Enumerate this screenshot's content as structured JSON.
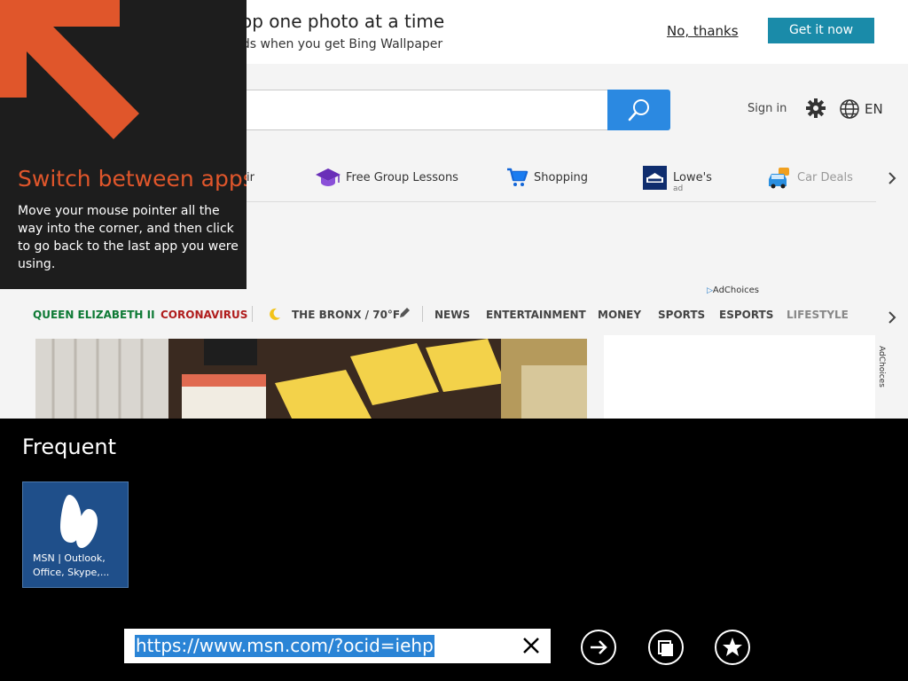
{
  "promo": {
    "line1": "m your desktop one photo at a time",
    "line2": "ch daily backgrounds when you get Bing Wallpaper",
    "no_thanks": "No, thanks",
    "get_it_now": "Get it now"
  },
  "header": {
    "sign_in": "Sign in",
    "language": "EN",
    "gear_icon": "gear-icon",
    "globe_icon": "globe-icon",
    "search_icon": "search-icon"
  },
  "quick_links": [
    {
      "label": "ir",
      "icon": "partial-icon"
    },
    {
      "label": "Free Group Lessons",
      "icon": "graduation-cap-icon"
    },
    {
      "label": "Shopping",
      "icon": "shopping-cart-icon"
    },
    {
      "label": "Lowe's",
      "sub": "ad",
      "icon": "lowes-logo-icon"
    },
    {
      "label": "Car Deals",
      "icon": "car-icon"
    }
  ],
  "ad_choices": "AdChoices",
  "nav": {
    "items": [
      "QUEEN ELIZABETH II",
      "CORONAVIRUS",
      "THE BRONX / 70°F",
      "NEWS",
      "ENTERTAINMENT",
      "MONEY",
      "SPORTS",
      "ESPORTS",
      "LIFESTYLE"
    ],
    "weather_icon": "moon-icon",
    "edit_icon": "pencil-icon"
  },
  "tip": {
    "title": "Switch between apps",
    "body": "Move your mouse pointer all the way into the corner, and then click to go back to the last app you were using."
  },
  "frequent": {
    "heading": "Frequent",
    "tiles": [
      {
        "label": "MSN | Outlook, Office, Skype,...",
        "icon": "msn-butterfly-icon"
      }
    ]
  },
  "address_bar": {
    "url": "https://www.msn.com/?ocid=iehp",
    "clear_icon": "close-icon",
    "go_icon": "arrow-right-icon",
    "tabs_icon": "tabs-icon",
    "favorites_icon": "star-icon"
  },
  "colors": {
    "accent_orange": "#e0562b",
    "search_blue": "#2b89e1",
    "cta_teal": "#1a8ba9",
    "tile_blue": "#1f4f8a",
    "selection_blue": "#2a84d6"
  }
}
